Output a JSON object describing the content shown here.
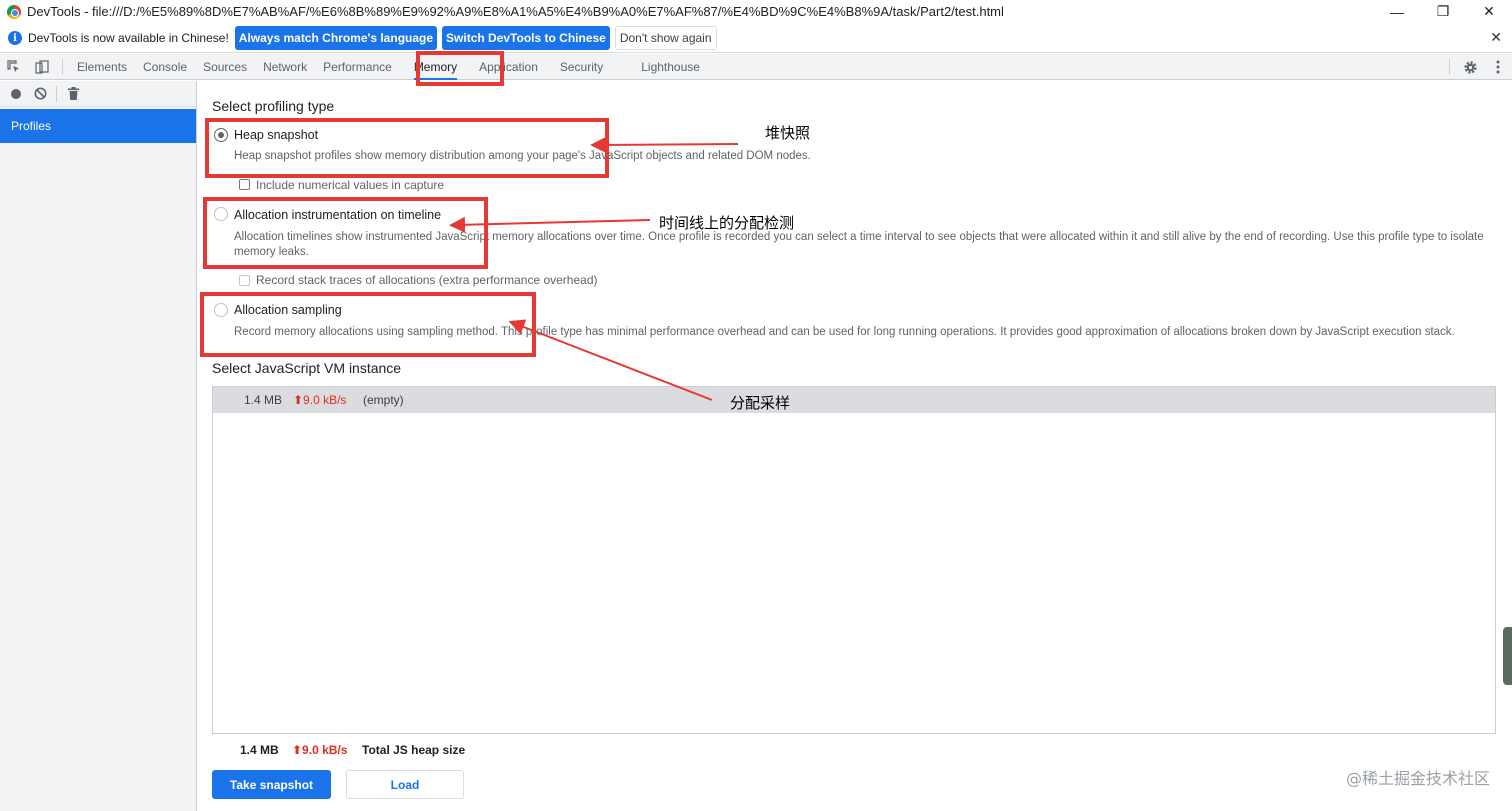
{
  "window": {
    "title": "DevTools - file:///D:/%E5%89%8D%E7%AB%AF/%E6%8B%89%E9%92%A9%E8%A1%A5%E4%B9%A0%E7%AF%87/%E4%BD%9C%E4%B8%9A/task/Part2/test.html",
    "minimize": "—",
    "restore": "❐",
    "close": "✕"
  },
  "infobar": {
    "icon": "i",
    "message": "DevTools is now available in Chinese!",
    "match_button": "Always match Chrome's language",
    "switch_button": "Switch DevTools to Chinese",
    "dismiss_button": "Don't show again",
    "close": "✕"
  },
  "tabs": {
    "items": [
      "Elements",
      "Console",
      "Sources",
      "Network",
      "Performance",
      "Memory",
      "Application",
      "Security",
      "Lighthouse"
    ],
    "active": "Memory"
  },
  "sidebar": {
    "profiles_label": "Profiles"
  },
  "profiling": {
    "title": "Select profiling type",
    "options": [
      {
        "label": "Heap snapshot",
        "desc": "Heap snapshot profiles show memory distribution among your page's JavaScript objects and related DOM nodes.",
        "checkbox": "Include numerical values in capture"
      },
      {
        "label": "Allocation instrumentation on timeline",
        "desc": "Allocation timelines show instrumented JavaScript memory allocations over time. Once profile is recorded you can select a time interval to see objects that were allocated within it and still alive by the end of recording. Use this profile type to isolate memory leaks.",
        "checkbox": "Record stack traces of allocations (extra performance overhead)"
      },
      {
        "label": "Allocation sampling",
        "desc": "Record memory allocations using sampling method. This profile type has minimal performance overhead and can be used for long running operations. It provides good approximation of allocations broken down by JavaScript execution stack."
      }
    ]
  },
  "vm": {
    "title": "Select JavaScript VM instance",
    "row": {
      "size": "1.4 MB",
      "rate": "⬆9.0 kB/s",
      "name": "(empty)"
    }
  },
  "summary": {
    "size": "1.4 MB",
    "rate": "⬆9.0 kB/s",
    "label": "Total JS heap size"
  },
  "actions": {
    "take_snapshot": "Take snapshot",
    "load": "Load"
  },
  "annotations": {
    "heap": "堆快照",
    "timeline": "时间线上的分配检测",
    "sampling": "分配采样"
  },
  "watermark": "@稀土掘金技术社区",
  "colors": {
    "accent": "#1a73e8",
    "annotation_red": "#e53935",
    "rate_red": "#d93025"
  }
}
